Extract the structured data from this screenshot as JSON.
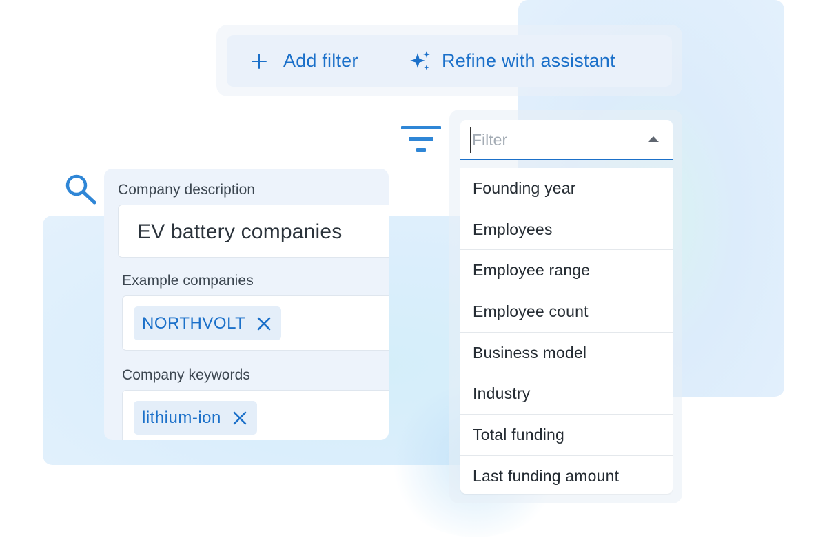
{
  "toolbar": {
    "add_filter_label": "Add filter",
    "refine_label": "Refine with assistant"
  },
  "filter_dropdown": {
    "placeholder": "Filter",
    "items": [
      "Founding year",
      "Employees",
      "Employee range",
      "Employee count",
      "Business model",
      "Industry",
      "Total funding",
      "Last funding amount"
    ]
  },
  "search_card": {
    "description_label": "Company description",
    "description_value": "EV battery companies",
    "examples_label": "Example companies",
    "example_chip": "NORTHVOLT",
    "keywords_label": "Company keywords",
    "keyword_chip": "lithium-ion"
  },
  "icons": {
    "add": "plus-icon",
    "refine": "sparkle-icon",
    "filter": "filter-icon",
    "search": "search-icon",
    "remove": "x-icon",
    "dropdown": "caret-up-icon"
  },
  "colors": {
    "accent": "#1b70c9",
    "icon_blue": "#2f86d6",
    "panel_bg": "#edf3fb",
    "toolbar_bg": "#eaf1fa"
  }
}
